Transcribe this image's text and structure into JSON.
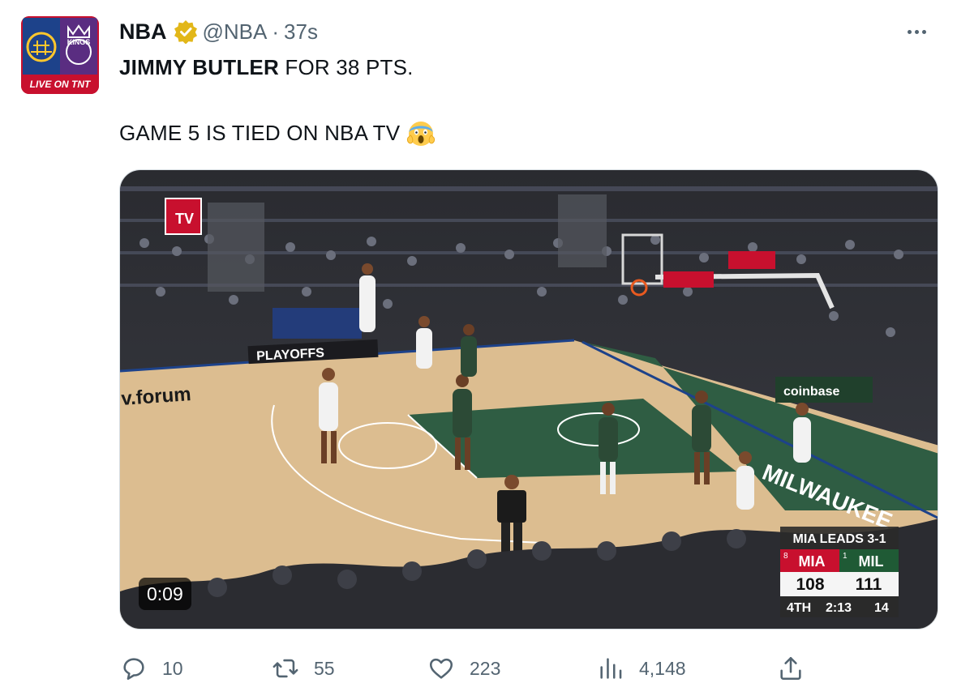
{
  "tweet": {
    "display_name": "NBA",
    "handle": "@NBA",
    "separator": "·",
    "timestamp": "37s",
    "line1_bold": "JIMMY BUTLER",
    "line1_rest": " FOR 38 PTS.",
    "line2": "GAME 5 IS TIED ON NBA TV"
  },
  "avatar": {
    "badge_text": "LIVE ON TNT",
    "team_text": "KINGS"
  },
  "video": {
    "duration": "0:09",
    "court_banner": "PLAYOFFS",
    "court_wordmark": "v.forum",
    "sponsor": "coinbase",
    "baseline": "MILWAUKEE",
    "channel_bug": "TV",
    "scoreboard": {
      "series": "MIA LEADS 3-1",
      "team1_seed": "8",
      "team1": "MIA",
      "team1_score": "108",
      "team2_seed": "1",
      "team2": "MIL",
      "team2_score": "111",
      "period": "4TH",
      "clock": "2:13",
      "shot_clock": "14"
    }
  },
  "actions": {
    "replies": "10",
    "retweets": "55",
    "likes": "223",
    "views": "4,148"
  },
  "colors": {
    "court": "#d8b98c",
    "paint": "#2f5d43",
    "scoreboard_red": "#c8102e",
    "scoreboard_green": "#1f5a35",
    "verified_gold": "#e2b719"
  }
}
